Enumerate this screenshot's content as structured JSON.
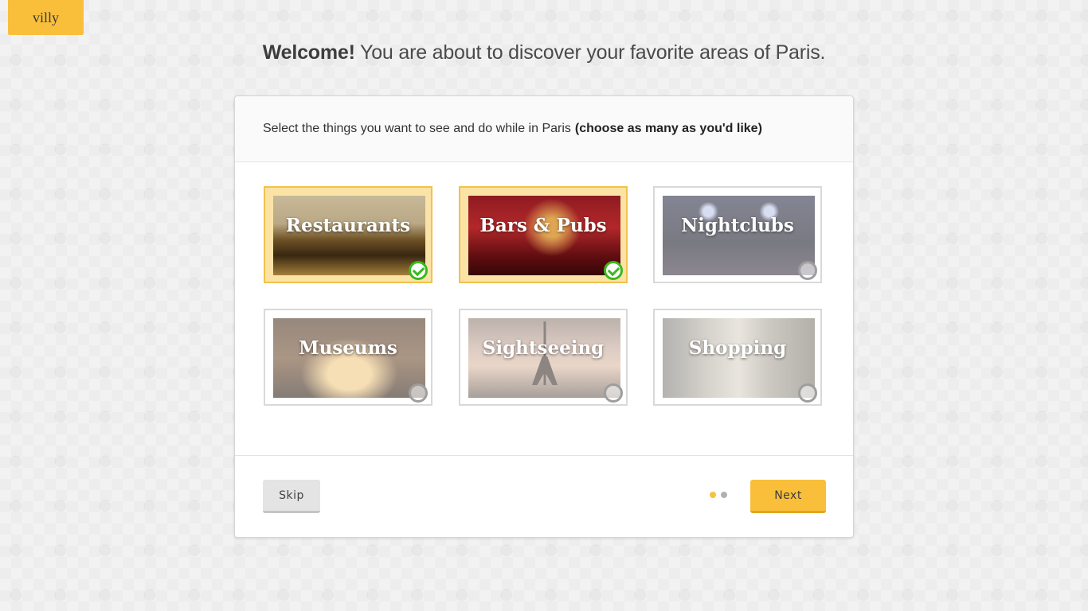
{
  "brand": {
    "logo_text": "villy",
    "accent_color": "#f9bf3b"
  },
  "welcome": {
    "bold": "Welcome!",
    "rest": " You are about to discover your favorite areas of Paris."
  },
  "modal": {
    "instruction": "Select the things you want to see and do while in Paris",
    "instruction_bold": "(choose as many as you'd like)"
  },
  "options": [
    {
      "label": "Restaurants",
      "selected": true
    },
    {
      "label": "Bars & Pubs",
      "selected": true
    },
    {
      "label": "Nightclubs",
      "selected": false
    },
    {
      "label": "Museums",
      "selected": false
    },
    {
      "label": "Sightseeing",
      "selected": false
    },
    {
      "label": "Shopping",
      "selected": false
    }
  ],
  "footer": {
    "skip_label": "Skip",
    "next_label": "Next",
    "progress": {
      "current_step": 1,
      "total_steps": 2
    }
  },
  "colors": {
    "selected_check": "#3bb81e",
    "selected_bg": "#fbe3a6"
  }
}
